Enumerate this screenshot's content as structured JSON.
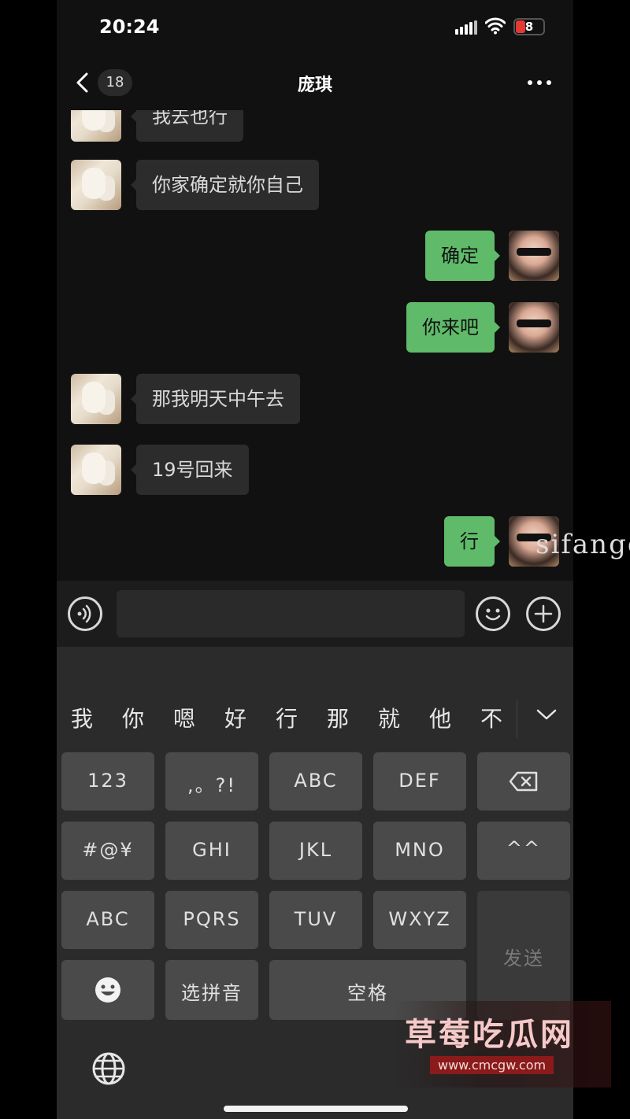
{
  "status": {
    "time": "20:24",
    "battery": "8"
  },
  "header": {
    "unread_count": "18",
    "title": "庞琪"
  },
  "messages": [
    {
      "side": "left",
      "text": "我去也行"
    },
    {
      "side": "left",
      "text": "你家确定就你自己"
    },
    {
      "side": "right",
      "text": "确定"
    },
    {
      "side": "right",
      "text": "你来吧"
    },
    {
      "side": "left",
      "text": "那我明天中午去"
    },
    {
      "side": "left",
      "text": "19号回来"
    },
    {
      "side": "right",
      "text": "行"
    }
  ],
  "keyboard": {
    "candidates": [
      "我",
      "你",
      "嗯",
      "好",
      "行",
      "那",
      "就",
      "他",
      "不"
    ],
    "keys": {
      "num": "123",
      "punct": ",。?!",
      "abc2": "ABC",
      "def": "DEF",
      "symbols": "#@¥",
      "ghi": "GHI",
      "jkl": "JKL",
      "mno": "MNO",
      "emoticon": "^^",
      "abc_switch": "ABC",
      "pqrs": "PQRS",
      "tuv": "TUV",
      "wxyz": "WXYZ",
      "send": "发送",
      "pinyin": "选拼音",
      "space": "空格"
    }
  },
  "watermarks": {
    "overlay_text": "sifangc",
    "logo_title": "草莓吃瓜网",
    "logo_url": "www.cmcgw.com"
  },
  "colors": {
    "sent_bubble": "#5fbb6a",
    "received_bubble": "#2c2c2c",
    "background": "#111111"
  }
}
